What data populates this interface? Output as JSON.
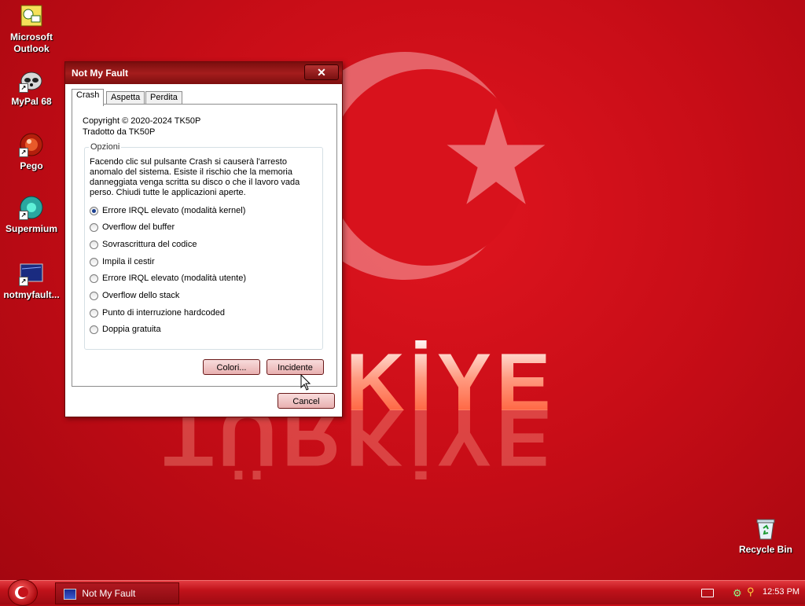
{
  "wallpaper": {
    "text": "TÜRKİYE"
  },
  "desktop": {
    "icons": [
      {
        "label": "Microsoft Outlook"
      },
      {
        "label": "MyPal 68"
      },
      {
        "label": "Pego"
      },
      {
        "label": "Supermium"
      },
      {
        "label": "notmyfault..."
      }
    ],
    "recycle_bin": {
      "label": "Recycle Bin"
    }
  },
  "window": {
    "title": "Not My Fault",
    "close_glyph": "✕",
    "tabs": [
      {
        "label": "Crash",
        "active": true
      },
      {
        "label": "Aspetta",
        "active": false
      },
      {
        "label": "Perdita",
        "active": false
      }
    ],
    "copyright": "Copyright © 2020-2024 TK50P",
    "translated_by": "Tradotto da TK50P",
    "options": {
      "legend": "Opzioni",
      "description": "Facendo clic sul pulsante Crash si causerà l'arresto anomalo del sistema. Esiste il rischio che la memoria danneggiata venga scritta su disco o che il lavoro vada perso. Chiudi tutte le applicazioni aperte.",
      "radios": [
        {
          "label": "Errore IRQL elevato (modalità kernel)",
          "checked": true
        },
        {
          "label": "Overflow del buffer",
          "checked": false
        },
        {
          "label": "Sovrascrittura del codice",
          "checked": false
        },
        {
          "label": "Impila il cestir",
          "checked": false
        },
        {
          "label": "Errore IRQL elevato (modalità utente)",
          "checked": false
        },
        {
          "label": "Overflow dello stack",
          "checked": false
        },
        {
          "label": "Punto di interruzione hardcoded",
          "checked": false
        },
        {
          "label": "Doppia gratuita",
          "checked": false
        }
      ]
    },
    "buttons": {
      "colors": "Colori...",
      "crash": "Incidente",
      "cancel": "Cancel"
    }
  },
  "taskbar": {
    "task": "Not My Fault",
    "time": "12:53 PM"
  }
}
